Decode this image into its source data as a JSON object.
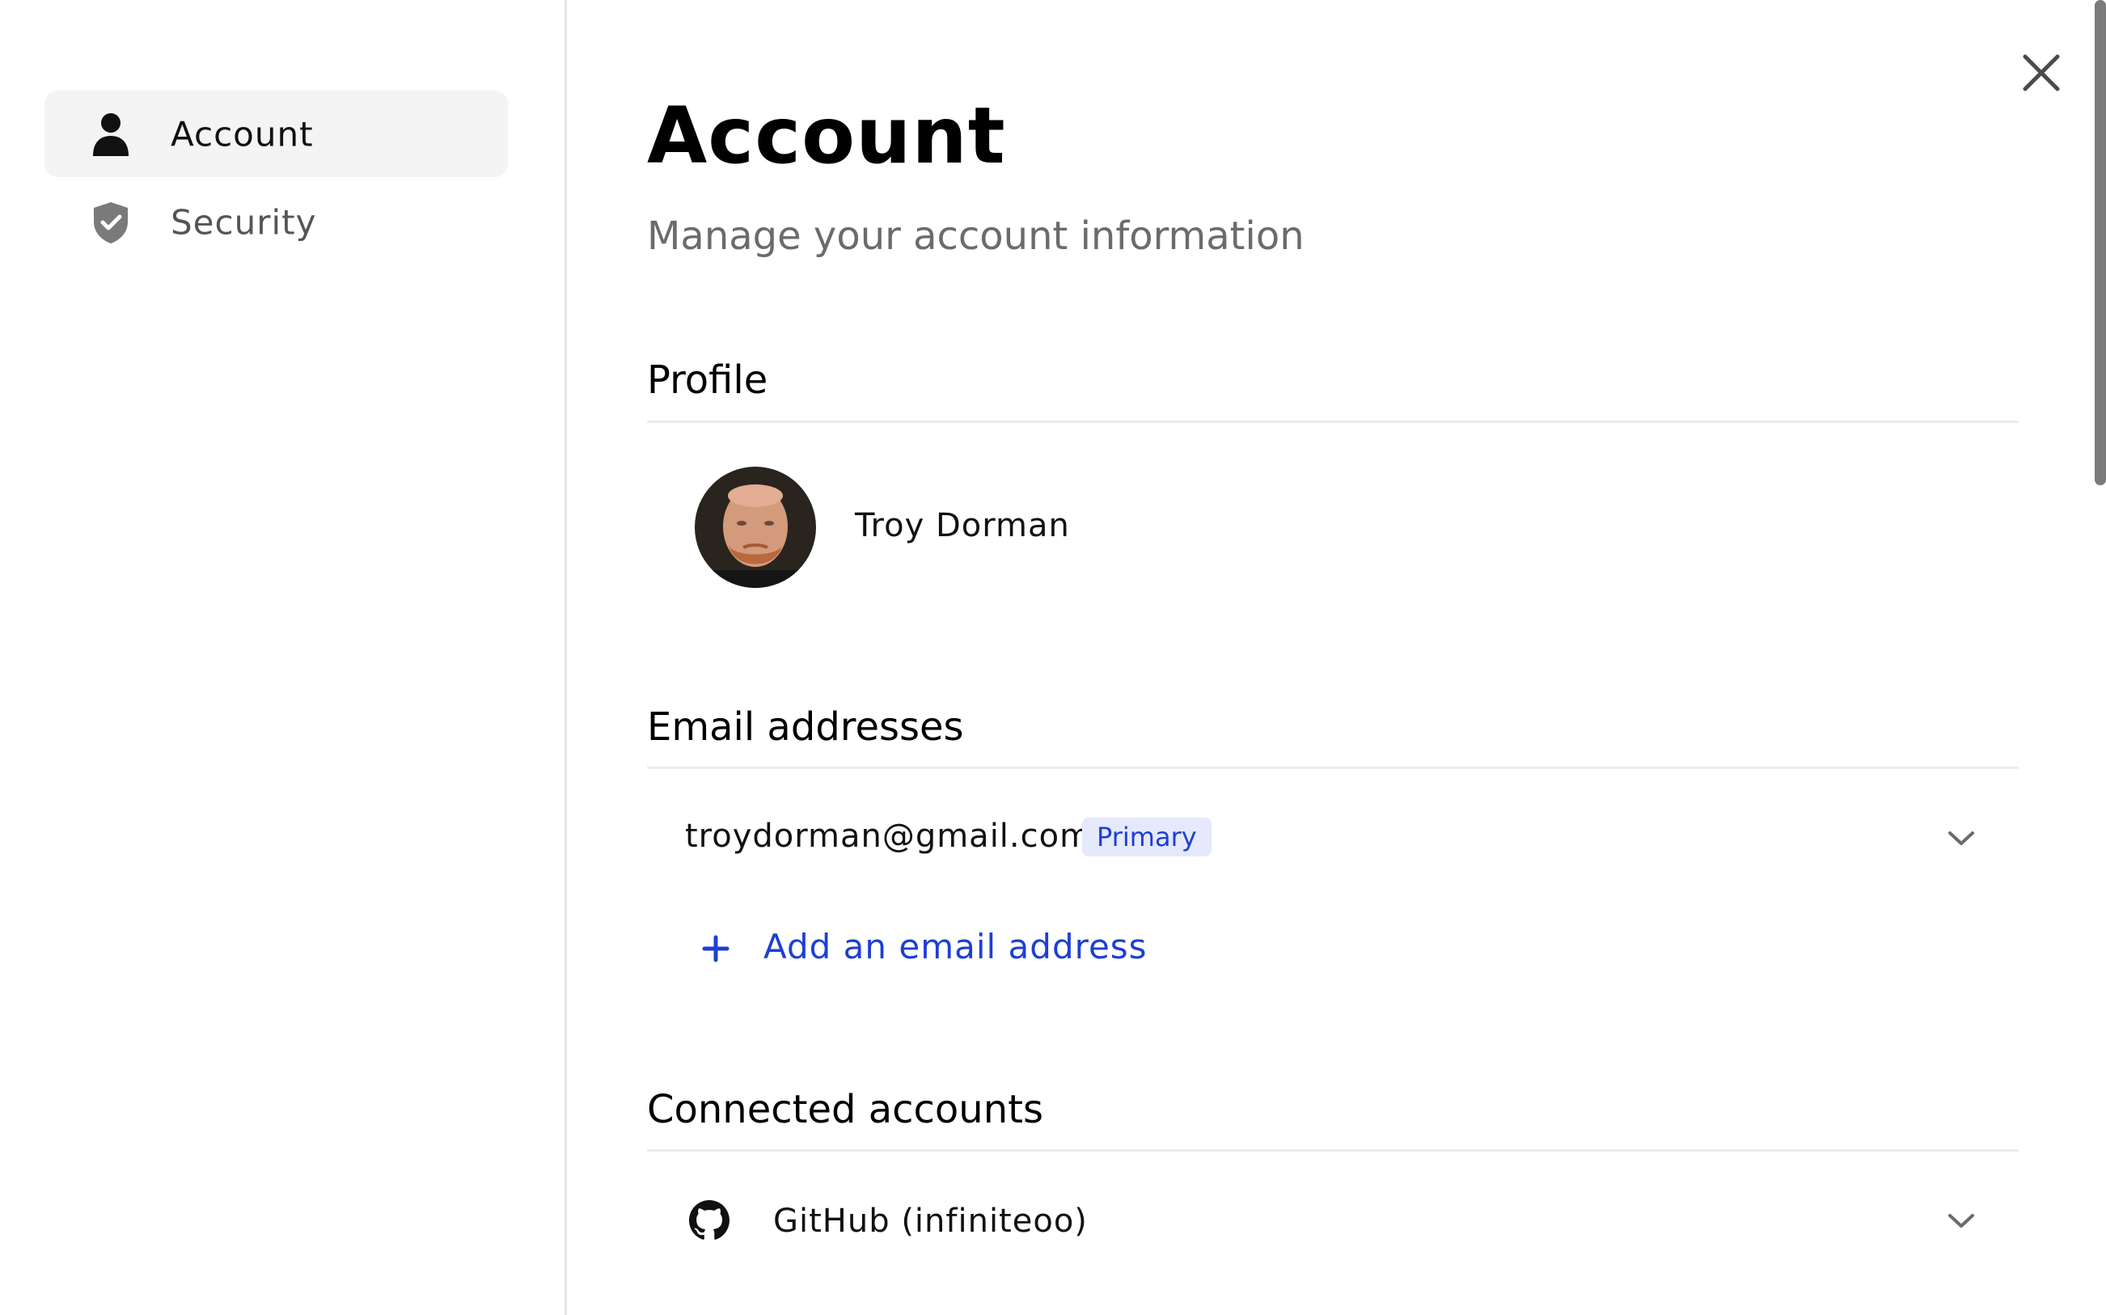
{
  "sidebar": {
    "items": [
      {
        "label": "Account",
        "icon": "user-icon",
        "active": true
      },
      {
        "label": "Security",
        "icon": "shield-check-icon",
        "active": false
      }
    ]
  },
  "header": {
    "title": "Account",
    "subtitle": "Manage your account information",
    "close_icon": "close-icon"
  },
  "profile": {
    "section_title": "Profile",
    "name": "Troy Dorman",
    "avatar": "avatar-photo"
  },
  "emails": {
    "section_title": "Email addresses",
    "items": [
      {
        "address": "troydorman@gmail.com",
        "badge": "Primary"
      }
    ],
    "add_label": "Add an email address"
  },
  "connected": {
    "section_title": "Connected accounts",
    "items": [
      {
        "label": "GitHub (infiniteoo)",
        "icon": "github-icon"
      }
    ]
  },
  "colors": {
    "accent": "#1d3fd6",
    "badge_bg": "#e5e9fb",
    "active_nav_bg": "#f4f4f4",
    "divider": "#ececec",
    "muted_text": "#6b6b6b"
  }
}
